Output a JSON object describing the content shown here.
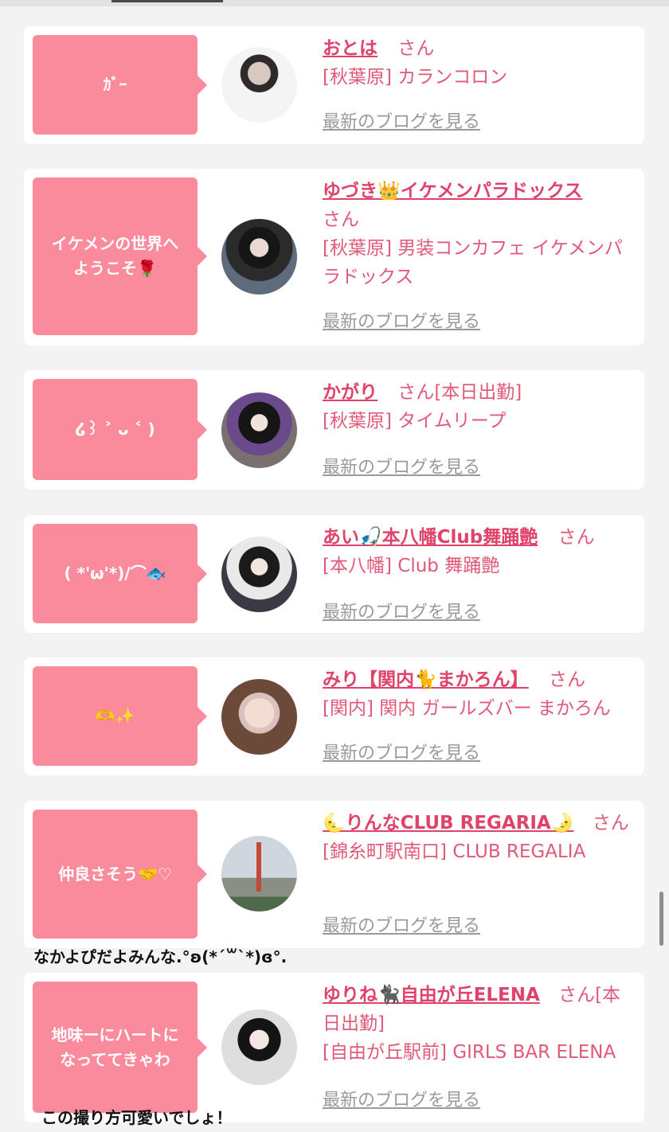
{
  "colors": {
    "accent": "#f98b9c",
    "name_link": "#e0436a",
    "text_pink": "#e05a78",
    "blog_link": "#9a9a9a"
  },
  "cards": [
    {
      "bubble": "ｶﾞｰ",
      "name": "おとは",
      "san": "さん",
      "status": "",
      "shop": "[秋葉原] カランコロン",
      "blog": "最新のブログを見る"
    },
    {
      "bubble": "イケメンの世界へ\nようこそ🌹",
      "name": "ゆづき👑イケメンパラドックス",
      "san": "さん",
      "status": "",
      "shop": "[秋葉原] 男装コンカフェ イケメンパラドックス",
      "blog": "最新のブログを見る"
    },
    {
      "bubble": "໒꒱ ˃ ᴗ ˂ )",
      "name": "かがり",
      "san": "さん",
      "status": "[本日出勤]",
      "shop": "[秋葉原] タイムリープ",
      "blog": "最新のブログを見る"
    },
    {
      "bubble": "( *'ω'*)/⌒🐟",
      "name": "あい🎣本八幡Club舞踊艶",
      "san": "さん",
      "status": "",
      "shop": "[本八幡] Club 舞踊艶",
      "blog": "最新のブログを見る"
    },
    {
      "bubble": "🫶✨",
      "name": "みり【関内🐈まかろん】",
      "san": "さん",
      "status": "",
      "shop": "[関内] 関内 ガールズバー まかろん",
      "blog": "最新のブログを見る"
    },
    {
      "bubble": "仲良さそう🤝♡",
      "name": "🌜りんなCLUB REGARIA🌛",
      "san": "さん",
      "status": "",
      "shop": "[錦糸町駅南口] CLUB REGALIA",
      "blog": "最新のブログを見る"
    },
    {
      "bubble": "地味ーにハートに\nなっててきゃわ",
      "name": "ゆりね🐈‍⬛自由が丘ELENA",
      "san": "さん",
      "status": "[本日出勤]",
      "shop": "[自由が丘駅前] GIRLS BAR ELENA",
      "blog": "最新のブログを見る"
    }
  ],
  "captions": {
    "caption_1": "なかよぴだよみんな.°ʚ(*´꒳`*)ɞ°.",
    "caption_2": "この撮り方可愛いでしょ！"
  }
}
